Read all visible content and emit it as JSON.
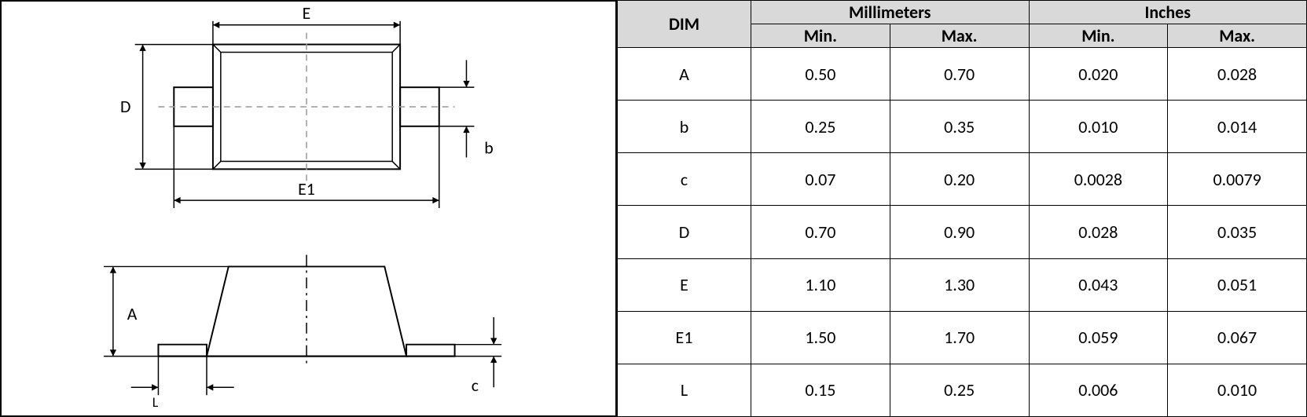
{
  "diagram": {
    "labels": {
      "E": "E",
      "D": "D",
      "b": "b",
      "E1": "E1",
      "A": "A",
      "L": "L",
      "c": "c"
    }
  },
  "table": {
    "headers": {
      "dim": "DIM",
      "mm": "Millimeters",
      "in": "Inches",
      "min": "Min.",
      "max": "Max."
    },
    "rows": [
      {
        "dim": "A",
        "mm_min": "0.50",
        "mm_max": "0.70",
        "in_min": "0.020",
        "in_max": "0.028"
      },
      {
        "dim": "b",
        "mm_min": "0.25",
        "mm_max": "0.35",
        "in_min": "0.010",
        "in_max": "0.014"
      },
      {
        "dim": "c",
        "mm_min": "0.07",
        "mm_max": "0.20",
        "in_min": "0.0028",
        "in_max": "0.0079"
      },
      {
        "dim": "D",
        "mm_min": "0.70",
        "mm_max": "0.90",
        "in_min": "0.028",
        "in_max": "0.035"
      },
      {
        "dim": "E",
        "mm_min": "1.10",
        "mm_max": "1.30",
        "in_min": "0.043",
        "in_max": "0.051"
      },
      {
        "dim": "E1",
        "mm_min": "1.50",
        "mm_max": "1.70",
        "in_min": "0.059",
        "in_max": "0.067"
      },
      {
        "dim": "L",
        "mm_min": "0.15",
        "mm_max": "0.25",
        "in_min": "0.006",
        "in_max": "0.010"
      }
    ]
  }
}
